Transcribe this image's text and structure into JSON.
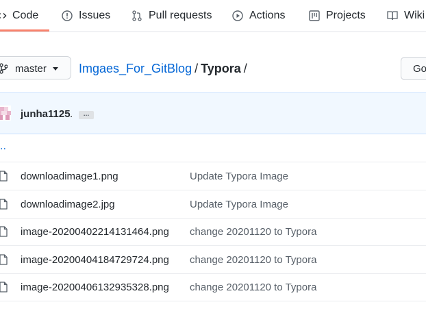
{
  "tabs": [
    {
      "label": "Code",
      "icon": "code-icon"
    },
    {
      "label": "Issues",
      "icon": "issue-icon"
    },
    {
      "label": "Pull requests",
      "icon": "pull-request-icon"
    },
    {
      "label": "Actions",
      "icon": "play-icon"
    },
    {
      "label": "Projects",
      "icon": "project-icon"
    },
    {
      "label": "Wiki",
      "icon": "book-icon"
    }
  ],
  "active_tab": "Code",
  "colors": {
    "accent_underline": "#f9826c",
    "link": "#0366d6",
    "commit_bar": "#f1f8ff"
  },
  "branch": {
    "label": "master"
  },
  "breadcrumb": {
    "repo": "Imgaes_For_GitBlog",
    "separator": "/",
    "folder": "Typora",
    "trailing": "/"
  },
  "goto_button": {
    "label": "Go"
  },
  "commit": {
    "author": "junha1125",
    "dot": ".",
    "ellipsis": "…"
  },
  "parent_dir": {
    "label": ".."
  },
  "files": [
    {
      "name": "downloadimage1.png",
      "message": "Update Typora Image"
    },
    {
      "name": "downloadimage2.jpg",
      "message": "Update Typora Image"
    },
    {
      "name": "image-20200402214131464.png",
      "message": "change 20201120 to Typora"
    },
    {
      "name": "image-20200404184729724.png",
      "message": "change 20201120 to Typora"
    },
    {
      "name": "image-20200406132935328.png",
      "message": "change 20201120 to Typora"
    }
  ]
}
